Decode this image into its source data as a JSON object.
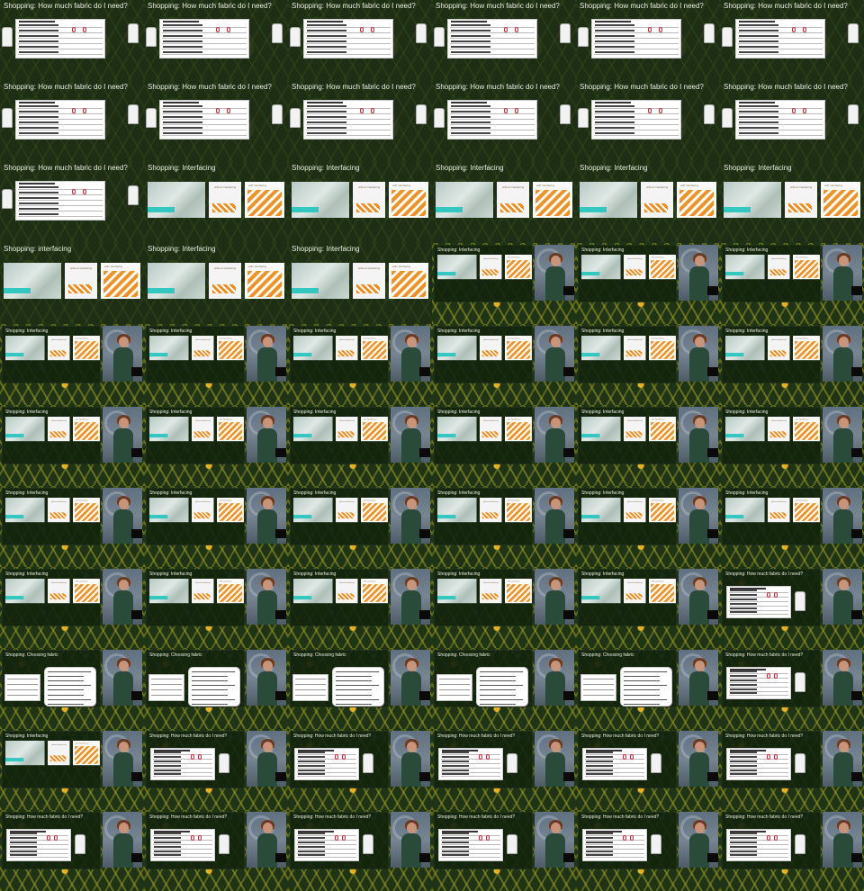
{
  "titles": {
    "fabric_amount": "Shopping: How much fabric do I need?",
    "interfacing": "Shopping: Interfacing",
    "interfacing_lower": "Shopping: interfacing",
    "choosing_fabric": "Shopping: Choosing fabric"
  },
  "interfacing_labels": {
    "without": "without interfacing",
    "with": "with interfacing"
  },
  "frames": [
    {
      "kind": "slide",
      "topic": "fabric_amount"
    },
    {
      "kind": "slide",
      "topic": "fabric_amount"
    },
    {
      "kind": "slide",
      "topic": "fabric_amount"
    },
    {
      "kind": "slide",
      "topic": "fabric_amount"
    },
    {
      "kind": "slide",
      "topic": "fabric_amount"
    },
    {
      "kind": "slide",
      "topic": "fabric_amount"
    },
    {
      "kind": "slide",
      "topic": "fabric_amount"
    },
    {
      "kind": "slide",
      "topic": "fabric_amount"
    },
    {
      "kind": "slide",
      "topic": "fabric_amount"
    },
    {
      "kind": "slide",
      "topic": "fabric_amount"
    },
    {
      "kind": "slide",
      "topic": "fabric_amount"
    },
    {
      "kind": "slide",
      "topic": "fabric_amount"
    },
    {
      "kind": "slide",
      "topic": "fabric_amount"
    },
    {
      "kind": "slide",
      "topic": "interfacing"
    },
    {
      "kind": "slide",
      "topic": "interfacing"
    },
    {
      "kind": "slide",
      "topic": "interfacing"
    },
    {
      "kind": "slide",
      "topic": "interfacing"
    },
    {
      "kind": "slide",
      "topic": "interfacing"
    },
    {
      "kind": "slide",
      "topic": "interfacing_lower"
    },
    {
      "kind": "slide",
      "topic": "interfacing"
    },
    {
      "kind": "slide",
      "topic": "interfacing"
    },
    {
      "kind": "stage",
      "topic": "interfacing"
    },
    {
      "kind": "stage",
      "topic": "interfacing"
    },
    {
      "kind": "stage",
      "topic": "interfacing"
    },
    {
      "kind": "stage",
      "topic": "interfacing"
    },
    {
      "kind": "stage",
      "topic": "interfacing"
    },
    {
      "kind": "stage",
      "topic": "interfacing"
    },
    {
      "kind": "stage",
      "topic": "interfacing"
    },
    {
      "kind": "stage",
      "topic": "interfacing"
    },
    {
      "kind": "stage",
      "topic": "interfacing"
    },
    {
      "kind": "stage",
      "topic": "interfacing"
    },
    {
      "kind": "stage",
      "topic": "interfacing"
    },
    {
      "kind": "stage",
      "topic": "interfacing"
    },
    {
      "kind": "stage",
      "topic": "interfacing"
    },
    {
      "kind": "stage",
      "topic": "interfacing"
    },
    {
      "kind": "stage",
      "topic": "interfacing"
    },
    {
      "kind": "stage",
      "topic": "interfacing"
    },
    {
      "kind": "stage",
      "topic": "interfacing"
    },
    {
      "kind": "stage",
      "topic": "interfacing"
    },
    {
      "kind": "stage",
      "topic": "interfacing"
    },
    {
      "kind": "stage",
      "topic": "interfacing"
    },
    {
      "kind": "stage",
      "topic": "interfacing"
    },
    {
      "kind": "stage",
      "topic": "interfacing"
    },
    {
      "kind": "stage",
      "topic": "interfacing"
    },
    {
      "kind": "stage",
      "topic": "interfacing"
    },
    {
      "kind": "stage",
      "topic": "interfacing"
    },
    {
      "kind": "stage",
      "topic": "interfacing"
    },
    {
      "kind": "stage",
      "topic": "fabric_amount"
    },
    {
      "kind": "stage",
      "topic": "choosing_fabric"
    },
    {
      "kind": "stage",
      "topic": "choosing_fabric"
    },
    {
      "kind": "stage",
      "topic": "choosing_fabric"
    },
    {
      "kind": "stage",
      "topic": "choosing_fabric"
    },
    {
      "kind": "stage",
      "topic": "choosing_fabric"
    },
    {
      "kind": "stage",
      "topic": "fabric_amount"
    },
    {
      "kind": "stage",
      "topic": "interfacing"
    },
    {
      "kind": "stage",
      "topic": "fabric_amount"
    },
    {
      "kind": "stage",
      "topic": "fabric_amount"
    },
    {
      "kind": "stage",
      "topic": "fabric_amount"
    },
    {
      "kind": "stage",
      "topic": "fabric_amount"
    },
    {
      "kind": "stage",
      "topic": "fabric_amount"
    },
    {
      "kind": "stage",
      "topic": "fabric_amount"
    },
    {
      "kind": "stage",
      "topic": "fabric_amount"
    },
    {
      "kind": "stage",
      "topic": "fabric_amount"
    },
    {
      "kind": "stage",
      "topic": "fabric_amount"
    },
    {
      "kind": "stage",
      "topic": "fabric_amount"
    },
    {
      "kind": "stage",
      "topic": "fabric_amount"
    }
  ],
  "colors": {
    "background_dark": "#1e2e14",
    "pattern_gold": "#e0a81a",
    "pattern_teal": "#2fa2a8",
    "interfacing_teal": "#34c7c0",
    "fabric_orange": "#f08a1a",
    "title_text": "#e8efe0"
  }
}
